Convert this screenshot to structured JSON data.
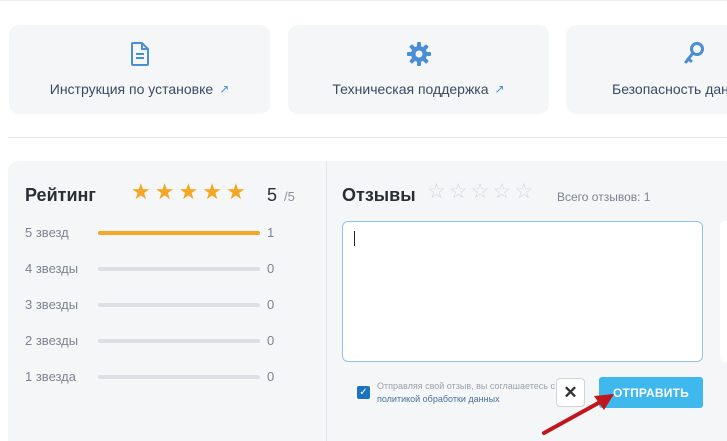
{
  "cards": [
    {
      "label": "Инструкция по установке",
      "icon": "document-icon"
    },
    {
      "label": "Техническая поддержка",
      "icon": "gear-icon"
    },
    {
      "label": "Безопасность данных",
      "icon": "key-icon"
    }
  ],
  "rating": {
    "title": "Рейтинг",
    "score": "5",
    "score_max": "/5",
    "rows": [
      {
        "label": "5 звезд",
        "count": "1",
        "fraction": 1.0
      },
      {
        "label": "4 звезды",
        "count": "0",
        "fraction": 0
      },
      {
        "label": "3 звезды",
        "count": "0",
        "fraction": 0
      },
      {
        "label": "2 звезды",
        "count": "0",
        "fraction": 0
      },
      {
        "label": "1 звезда",
        "count": "0",
        "fraction": 0
      }
    ],
    "stars_filled": 5
  },
  "reviews": {
    "title": "Отзывы",
    "total_label": "Всего отзывов: 1",
    "textarea_value": "",
    "consent_text": "Отправляя свой отзыв, вы соглашаетесь с",
    "consent_link": "политикой обработки данных",
    "cancel_label": "✕",
    "submit_label": "ОТПРАВИТЬ"
  },
  "colors": {
    "accent_blue": "#3fb8ee",
    "star_gold": "#f5a623",
    "annotation_red": "#c0161c"
  }
}
